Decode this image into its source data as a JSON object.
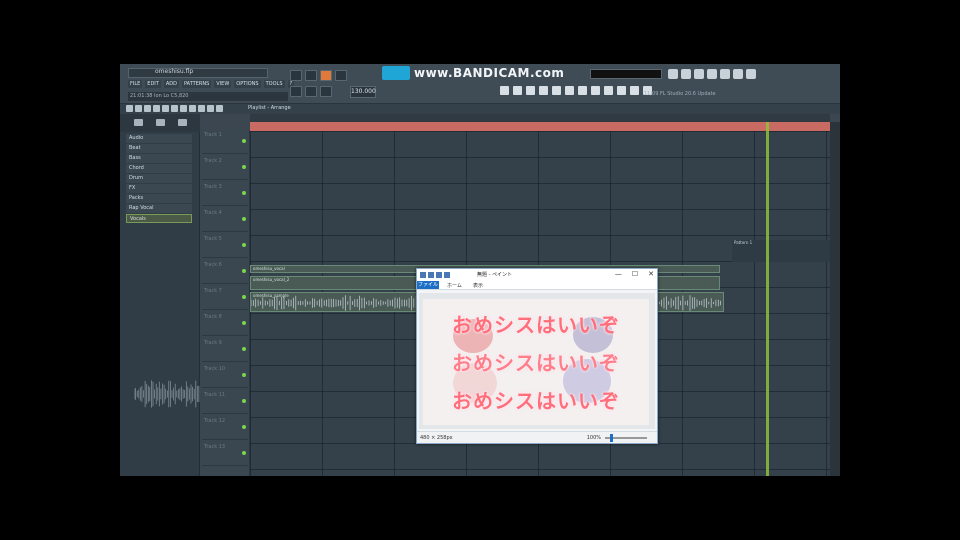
{
  "app": {
    "title": "omeshisu.flp",
    "menu": [
      "FILE",
      "EDIT",
      "ADD",
      "PATTERNS",
      "VIEW",
      "OPTIONS",
      "TOOLS",
      "?"
    ],
    "hint": "21:01:38  Ion  Lo  C5,820",
    "tempo": "130.000",
    "status_right": "11/09   FL Studio 20.6 Update"
  },
  "watermark": {
    "text": "www.BANDICAM.com"
  },
  "playlist": {
    "breadcrumb": "Playlist - Arrange",
    "track_labels": [
      "Track 1",
      "Track 2",
      "Track 3",
      "Track 4",
      "Track 5",
      "Track 6",
      "Track 7",
      "Track 8",
      "Track 9",
      "Track 10",
      "Track 11",
      "Track 12",
      "Track 13"
    ],
    "clip_labels": [
      "omeshisu_vocal",
      "omeshisu_vocal_2",
      "omeshisu_sample"
    ],
    "side_label": "Pattern 1"
  },
  "browser": {
    "items": [
      "Audio",
      "Beat",
      "Bass",
      "Chord",
      "Drum",
      "FX",
      "Packs",
      "Rap Vocal",
      "Vocals"
    ]
  },
  "paint": {
    "title": "無題 - ペイント",
    "tabs": [
      "ファイル",
      "ホーム",
      "表示"
    ],
    "lines": [
      "おめシスはいいぞ",
      "おめシスはいいぞ",
      "おめシスはいいぞ"
    ],
    "status_size": "480 × 258px",
    "zoom": "100%",
    "window_controls": [
      "—",
      "☐",
      "✕"
    ]
  },
  "colors": {
    "accent": "#1fa6d6",
    "ruler": "#c96a63",
    "playhead": "#8fbf3a",
    "paint_text": "#ff6e7a"
  }
}
